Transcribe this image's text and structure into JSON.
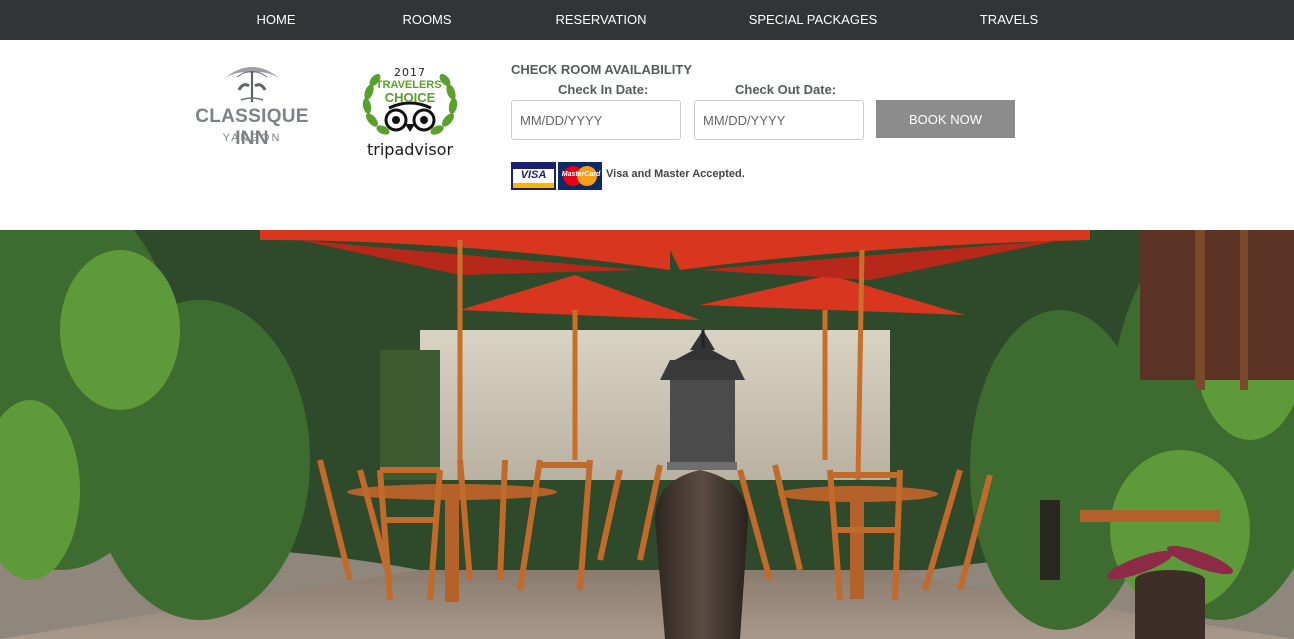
{
  "nav": {
    "items": [
      {
        "label": "HOME"
      },
      {
        "label": "ROOMS"
      },
      {
        "label": "RESERVATION"
      },
      {
        "label": "SPECIAL PACKAGES"
      },
      {
        "label": "TRAVELS"
      }
    ]
  },
  "logo": {
    "name": "CLASSIQUE INN",
    "city": "YANGON",
    "emblem_text": "CLASSIQUE INN",
    "color": "#7e8288"
  },
  "tripadvisor": {
    "year": "2017",
    "line1": "TRAVELERS'",
    "line2": "CHOICE",
    "brand": "tripadvisor",
    "laurel_color": "#5aa02c"
  },
  "availability": {
    "title": "CHECK ROOM AVAILABILITY",
    "check_in_label": "Check In Date:",
    "check_in_placeholder": "MM/DD/YYYY",
    "check_out_label": "Check Out Date:",
    "check_out_placeholder": "MM/DD/YYYY",
    "book_label": "BOOK NOW"
  },
  "payment": {
    "visa_label": "VISA",
    "mastercard_label": "MasterCard",
    "note": "Visa and Master Accepted."
  },
  "colors": {
    "nav_bg": "#323436",
    "button_bg": "#8c8c8c",
    "umbrella": "#d8361e"
  }
}
